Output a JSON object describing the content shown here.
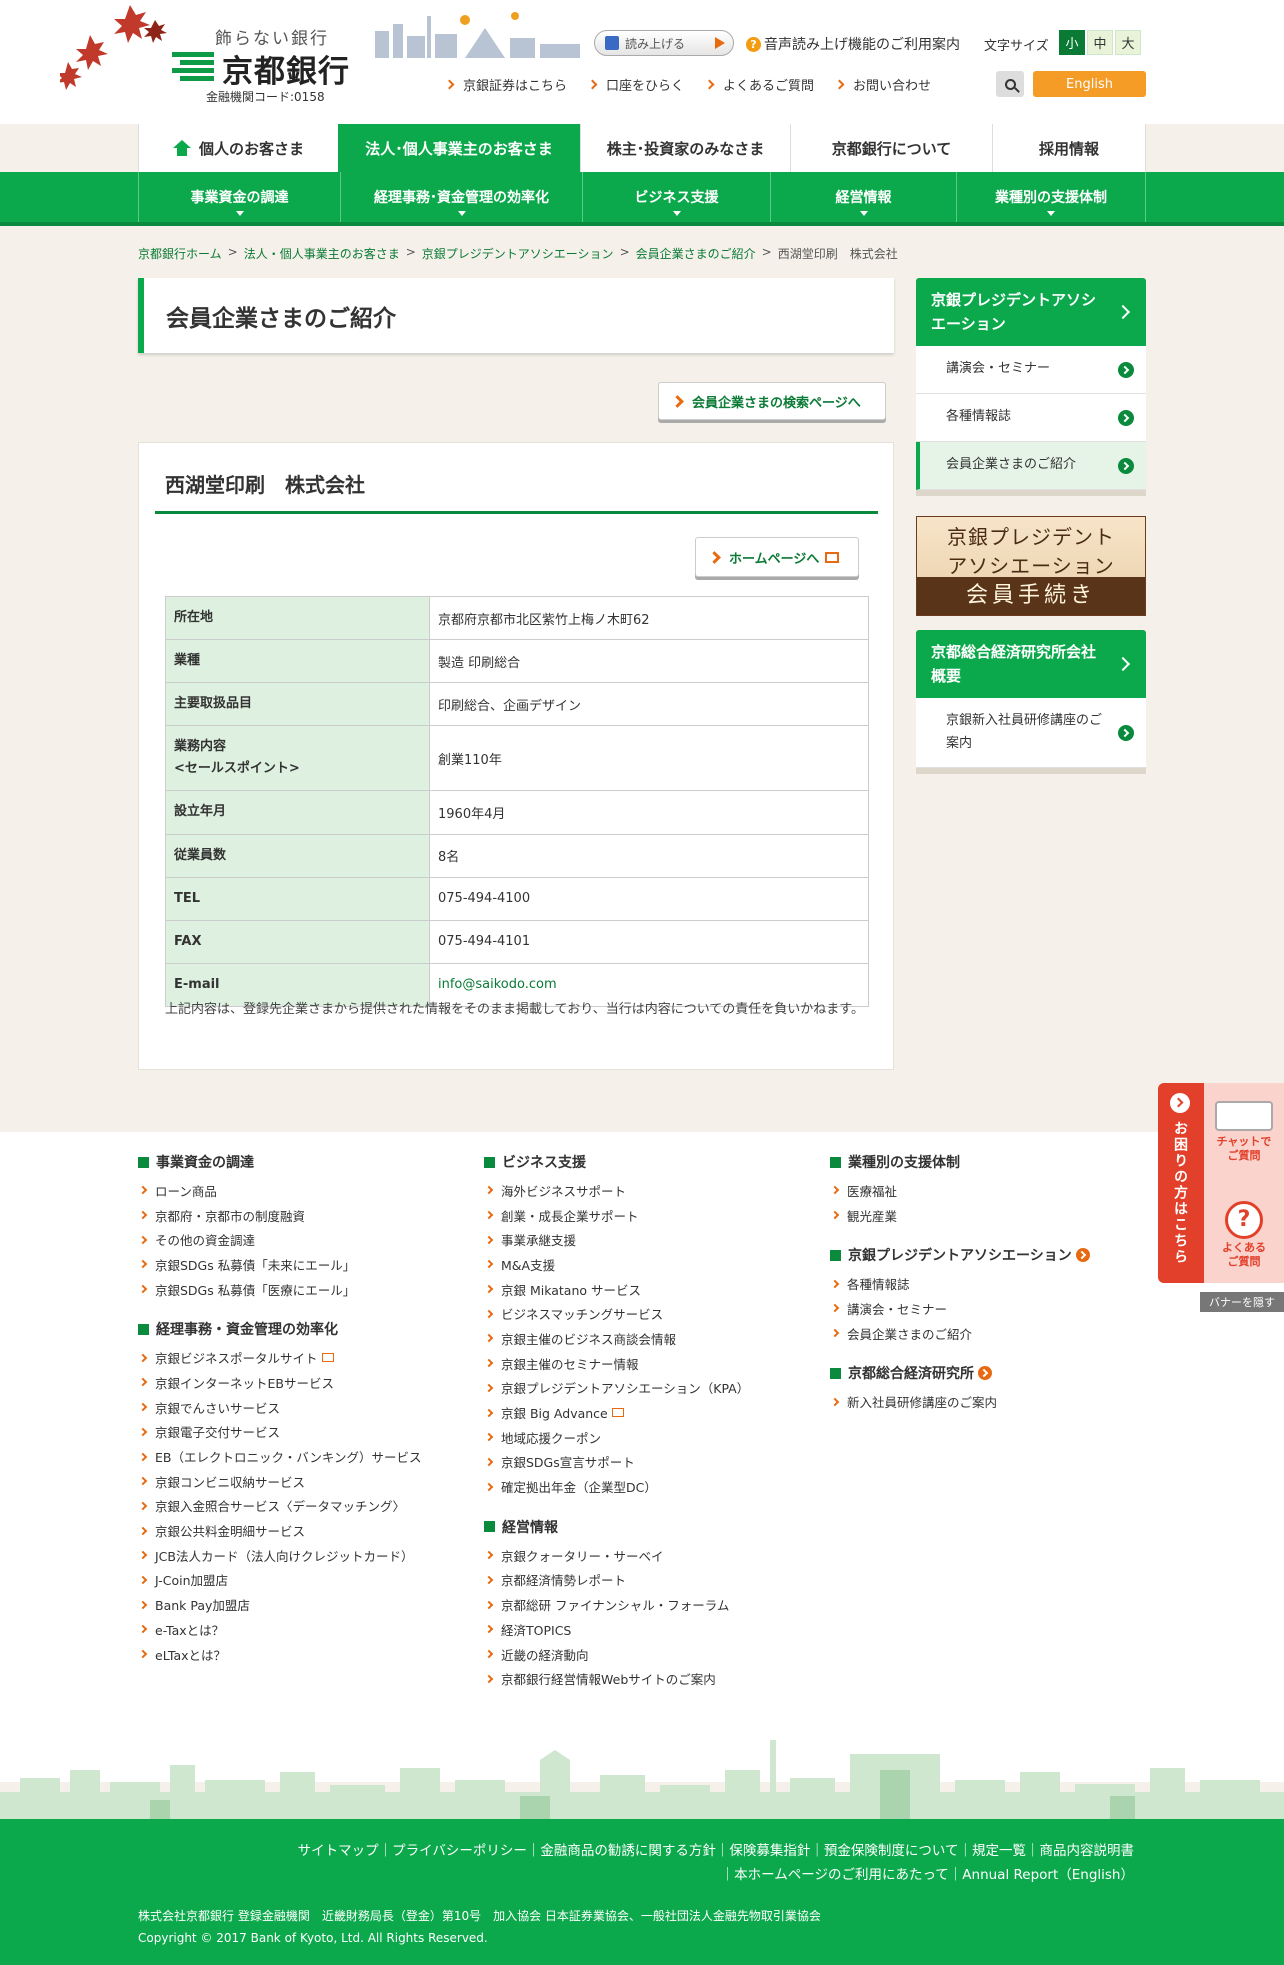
{
  "header": {
    "tagline": "飾らない銀行",
    "logo_name": "京都銀行",
    "bank_code": "金融機関コード:0158",
    "read_aloud": "読み上げる",
    "voice_guide": "音声読み上げ機能のご利用案内",
    "font_size_label": "文字サイズ",
    "font_sizes": [
      "小",
      "中",
      "大"
    ],
    "util_links": [
      "京銀証券はこちら",
      "口座をひらく",
      "よくあるご質問",
      "お問い合わせ"
    ],
    "english": "English"
  },
  "main_nav": [
    "個人のお客さま",
    "法人･個人事業主のお客さま",
    "株主･投資家のみなさま",
    "京都銀行について",
    "採用情報"
  ],
  "sub_nav": [
    "事業資金の調達",
    "経理事務･資金管理の効率化",
    "ビジネス支援",
    "経営情報",
    "業種別の支援体制"
  ],
  "breadcrumb": [
    "京都銀行ホーム",
    "法人・個人事業主のお客さま",
    "京銀プレジデントアソシエーション",
    "会員企業さまのご紹介",
    "西湖堂印刷　株式会社"
  ],
  "page_title": "会員企業さまのご紹介",
  "search_page_button": "会員企業さまの検索ページへ",
  "company": {
    "name": "西湖堂印刷　株式会社",
    "homepage_button": "ホームページへ",
    "rows": [
      {
        "label": "所在地",
        "value": "京都府京都市北区紫竹上梅ノ木町62"
      },
      {
        "label": "業種",
        "value": "製造 印刷総合"
      },
      {
        "label": "主要取扱品目",
        "value": "印刷総合、企画デザイン"
      },
      {
        "label": "業務内容\n<セールスポイント>",
        "value": "創業110年"
      },
      {
        "label": "設立年月",
        "value": "1960年4月"
      },
      {
        "label": "従業員数",
        "value": "8名"
      },
      {
        "label": "TEL",
        "value": "075-494-4100"
      },
      {
        "label": "FAX",
        "value": "075-494-4101"
      },
      {
        "label": "E-mail",
        "value": "info@saikodo.com"
      }
    ],
    "disclaimer": "上記内容は、登録先企業さまから提供された情報をそのまま掲載しており、当行は内容についての責任を負いかねます。"
  },
  "sidebar": {
    "section1_title": "京銀プレジデントアソシエーション",
    "section1_items": [
      "講演会・セミナー",
      "各種情報誌",
      "会員企業さまのご紹介"
    ],
    "banner_line1": "京銀プレジデント",
    "banner_line2": "アソシエーション",
    "banner_line3": "会員手続き",
    "section2_title": "京都総合経済研究所会社概要",
    "section2_items": [
      "京銀新入社員研修講座のご案内"
    ]
  },
  "footer_columns": {
    "col1": [
      {
        "title": "事業資金の調達",
        "items": [
          "ローン商品",
          "京都府・京都市の制度融資",
          "その他の資金調達",
          "京銀SDGs 私募債「未来にエール」",
          "京銀SDGs 私募債「医療にエール」"
        ]
      },
      {
        "title": "経理事務・資金管理の効率化",
        "items": [
          "京銀ビジネスポータルサイト",
          "京銀インターネットEBサービス",
          "京銀でんさいサービス",
          "京銀電子交付サービス",
          "EB（エレクトロニック・バンキング）サービス",
          "京銀コンビニ収納サービス",
          "京銀入金照合サービス〈データマッチング〉",
          "京銀公共料金明細サービス",
          "JCB法人カード（法人向けクレジットカード）",
          "J-Coin加盟店",
          "Bank Pay加盟店",
          "e-Taxとは？",
          "eLTaxとは？"
        ]
      }
    ],
    "col2": [
      {
        "title": "ビジネス支援",
        "items": [
          "海外ビジネスサポート",
          "創業・成長企業サポート",
          "事業承継支援",
          "M&A支援",
          "京銀 Mikatano サービス",
          "ビジネスマッチングサービス",
          "京銀主催のビジネス商談会情報",
          "京銀主催のセミナー情報",
          "京銀プレジデントアソシエーション（KPA）",
          "京銀 Big Advance",
          "地域応援クーポン",
          "京銀SDGs宣言サポート",
          "確定拠出年金（企業型DC）"
        ]
      },
      {
        "title": "経営情報",
        "items": [
          "京銀クォータリー・サーベイ",
          "京都経済情勢レポート",
          "京都総研 ファイナンシャル・フォーラム",
          "経済TOPICS",
          "近畿の経済動向",
          "京都銀行経営情報Webサイトのご案内"
        ]
      }
    ],
    "col3": [
      {
        "title": "業種別の支援体制",
        "items": [
          "医療福祉",
          "観光産業"
        ]
      },
      {
        "title": "京銀プレジデントアソシエーション",
        "items": [
          "各種情報誌",
          "講演会・セミナー",
          "会員企業さまのご紹介"
        ]
      },
      {
        "title": "京都総合経済研究所",
        "items": [
          "新入社員研修講座のご案内"
        ]
      }
    ]
  },
  "footer": {
    "policy_line1": "サイトマップ｜プライバシーポリシー｜金融商品の勧誘に関する方針｜保険募集指針｜預金保険制度について｜規定一覧｜商品内容説明書",
    "policy_line2": "｜本ホームページのご利用にあたって｜Annual Report（English）",
    "legal": "株式会社京都銀行 登録金融機関　近畿財務局長（登金）第10号　加入協会 日本証券業協会、一般社団法人金融先物取引業協会",
    "copyright": "Copyright © 2017 Bank of Kyoto, Ltd. All Rights Reserved."
  },
  "help_banner": {
    "title": "お困りの方はこちら",
    "chat": "チャットで\nご質問",
    "faq": "よくある\nご質問",
    "hide": "バナーを隠す"
  },
  "colors": {
    "brand_green": "#0ba94c",
    "accent_orange": "#e86a10",
    "help_red": "#e2402b"
  }
}
